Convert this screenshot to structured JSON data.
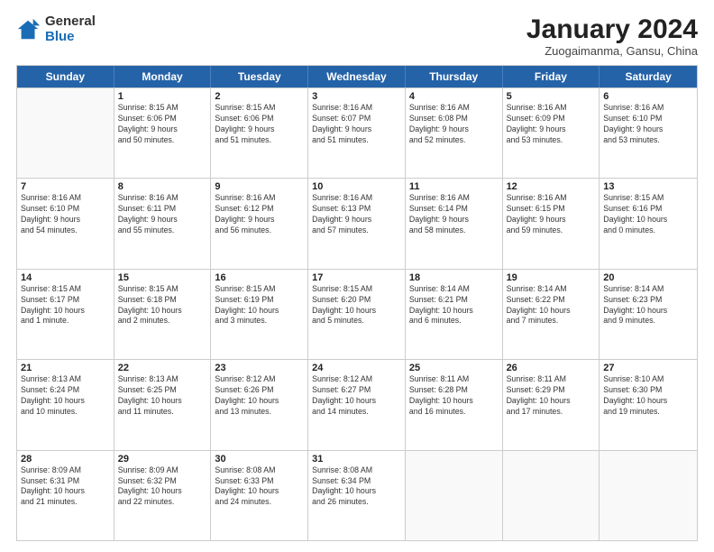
{
  "logo": {
    "general": "General",
    "blue": "Blue"
  },
  "title": "January 2024",
  "location": "Zuogaimanma, Gansu, China",
  "headers": [
    "Sunday",
    "Monday",
    "Tuesday",
    "Wednesday",
    "Thursday",
    "Friday",
    "Saturday"
  ],
  "weeks": [
    [
      {
        "day": "",
        "info": ""
      },
      {
        "day": "1",
        "info": "Sunrise: 8:15 AM\nSunset: 6:06 PM\nDaylight: 9 hours\nand 50 minutes."
      },
      {
        "day": "2",
        "info": "Sunrise: 8:15 AM\nSunset: 6:06 PM\nDaylight: 9 hours\nand 51 minutes."
      },
      {
        "day": "3",
        "info": "Sunrise: 8:16 AM\nSunset: 6:07 PM\nDaylight: 9 hours\nand 51 minutes."
      },
      {
        "day": "4",
        "info": "Sunrise: 8:16 AM\nSunset: 6:08 PM\nDaylight: 9 hours\nand 52 minutes."
      },
      {
        "day": "5",
        "info": "Sunrise: 8:16 AM\nSunset: 6:09 PM\nDaylight: 9 hours\nand 53 minutes."
      },
      {
        "day": "6",
        "info": "Sunrise: 8:16 AM\nSunset: 6:10 PM\nDaylight: 9 hours\nand 53 minutes."
      }
    ],
    [
      {
        "day": "7",
        "info": "Sunrise: 8:16 AM\nSunset: 6:10 PM\nDaylight: 9 hours\nand 54 minutes."
      },
      {
        "day": "8",
        "info": "Sunrise: 8:16 AM\nSunset: 6:11 PM\nDaylight: 9 hours\nand 55 minutes."
      },
      {
        "day": "9",
        "info": "Sunrise: 8:16 AM\nSunset: 6:12 PM\nDaylight: 9 hours\nand 56 minutes."
      },
      {
        "day": "10",
        "info": "Sunrise: 8:16 AM\nSunset: 6:13 PM\nDaylight: 9 hours\nand 57 minutes."
      },
      {
        "day": "11",
        "info": "Sunrise: 8:16 AM\nSunset: 6:14 PM\nDaylight: 9 hours\nand 58 minutes."
      },
      {
        "day": "12",
        "info": "Sunrise: 8:16 AM\nSunset: 6:15 PM\nDaylight: 9 hours\nand 59 minutes."
      },
      {
        "day": "13",
        "info": "Sunrise: 8:15 AM\nSunset: 6:16 PM\nDaylight: 10 hours\nand 0 minutes."
      }
    ],
    [
      {
        "day": "14",
        "info": "Sunrise: 8:15 AM\nSunset: 6:17 PM\nDaylight: 10 hours\nand 1 minute."
      },
      {
        "day": "15",
        "info": "Sunrise: 8:15 AM\nSunset: 6:18 PM\nDaylight: 10 hours\nand 2 minutes."
      },
      {
        "day": "16",
        "info": "Sunrise: 8:15 AM\nSunset: 6:19 PM\nDaylight: 10 hours\nand 3 minutes."
      },
      {
        "day": "17",
        "info": "Sunrise: 8:15 AM\nSunset: 6:20 PM\nDaylight: 10 hours\nand 5 minutes."
      },
      {
        "day": "18",
        "info": "Sunrise: 8:14 AM\nSunset: 6:21 PM\nDaylight: 10 hours\nand 6 minutes."
      },
      {
        "day": "19",
        "info": "Sunrise: 8:14 AM\nSunset: 6:22 PM\nDaylight: 10 hours\nand 7 minutes."
      },
      {
        "day": "20",
        "info": "Sunrise: 8:14 AM\nSunset: 6:23 PM\nDaylight: 10 hours\nand 9 minutes."
      }
    ],
    [
      {
        "day": "21",
        "info": "Sunrise: 8:13 AM\nSunset: 6:24 PM\nDaylight: 10 hours\nand 10 minutes."
      },
      {
        "day": "22",
        "info": "Sunrise: 8:13 AM\nSunset: 6:25 PM\nDaylight: 10 hours\nand 11 minutes."
      },
      {
        "day": "23",
        "info": "Sunrise: 8:12 AM\nSunset: 6:26 PM\nDaylight: 10 hours\nand 13 minutes."
      },
      {
        "day": "24",
        "info": "Sunrise: 8:12 AM\nSunset: 6:27 PM\nDaylight: 10 hours\nand 14 minutes."
      },
      {
        "day": "25",
        "info": "Sunrise: 8:11 AM\nSunset: 6:28 PM\nDaylight: 10 hours\nand 16 minutes."
      },
      {
        "day": "26",
        "info": "Sunrise: 8:11 AM\nSunset: 6:29 PM\nDaylight: 10 hours\nand 17 minutes."
      },
      {
        "day": "27",
        "info": "Sunrise: 8:10 AM\nSunset: 6:30 PM\nDaylight: 10 hours\nand 19 minutes."
      }
    ],
    [
      {
        "day": "28",
        "info": "Sunrise: 8:09 AM\nSunset: 6:31 PM\nDaylight: 10 hours\nand 21 minutes."
      },
      {
        "day": "29",
        "info": "Sunrise: 8:09 AM\nSunset: 6:32 PM\nDaylight: 10 hours\nand 22 minutes."
      },
      {
        "day": "30",
        "info": "Sunrise: 8:08 AM\nSunset: 6:33 PM\nDaylight: 10 hours\nand 24 minutes."
      },
      {
        "day": "31",
        "info": "Sunrise: 8:08 AM\nSunset: 6:34 PM\nDaylight: 10 hours\nand 26 minutes."
      },
      {
        "day": "",
        "info": ""
      },
      {
        "day": "",
        "info": ""
      },
      {
        "day": "",
        "info": ""
      }
    ]
  ]
}
